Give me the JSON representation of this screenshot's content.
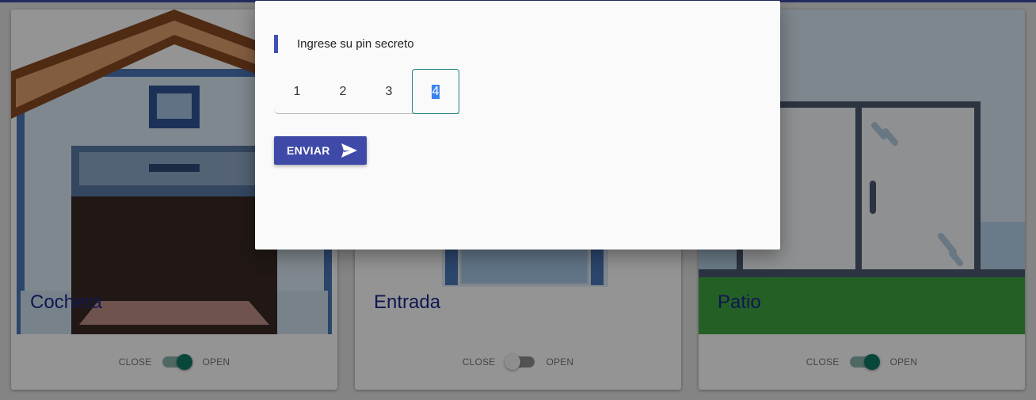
{
  "cards": [
    {
      "title": "Cochera",
      "close_label": "CLOSE",
      "open_label": "OPEN",
      "switch_state": "open",
      "image_icon": "garage-icon"
    },
    {
      "title": "Entrada",
      "close_label": "CLOSE",
      "open_label": "OPEN",
      "switch_state": "close",
      "image_icon": "house-entrance-icon"
    },
    {
      "title": "Patio",
      "close_label": "CLOSE",
      "open_label": "OPEN",
      "switch_state": "open",
      "image_icon": "patio-door-icon"
    }
  ],
  "modal": {
    "label": "Ingrese su pin secreto",
    "pin_digits": [
      "1",
      "2",
      "3",
      "4"
    ],
    "active_index": 3,
    "send_label": "ENVIAR",
    "send_icon": "send-icon"
  },
  "colors": {
    "accent": "#3f51b5",
    "switch_on": "#107b6a",
    "title": "#1c2a8c",
    "patio_grass": "#3fa640"
  }
}
